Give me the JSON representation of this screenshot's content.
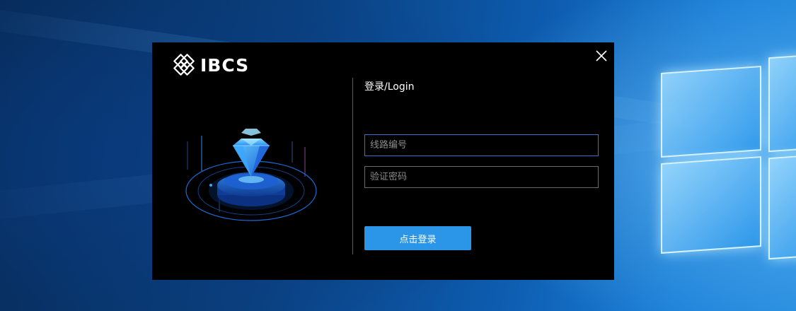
{
  "dialog": {
    "brand_name": "IBCS",
    "brand_icon": "knot-logo-icon",
    "close_icon": "close-icon",
    "illustration_icon": "diamond-platform-icon",
    "login_title": "登录/Login",
    "fields": {
      "line_number_placeholder": "线路编号",
      "password_placeholder": "验证密码",
      "line_number_value": "",
      "password_value": ""
    },
    "login_button_label": "点击登录"
  },
  "colors": {
    "dialog_background": "#000000",
    "button_accent": "#2b95e8",
    "active_field_border": "#3d6fd0",
    "desktop_accent": "#1a7fd6"
  }
}
